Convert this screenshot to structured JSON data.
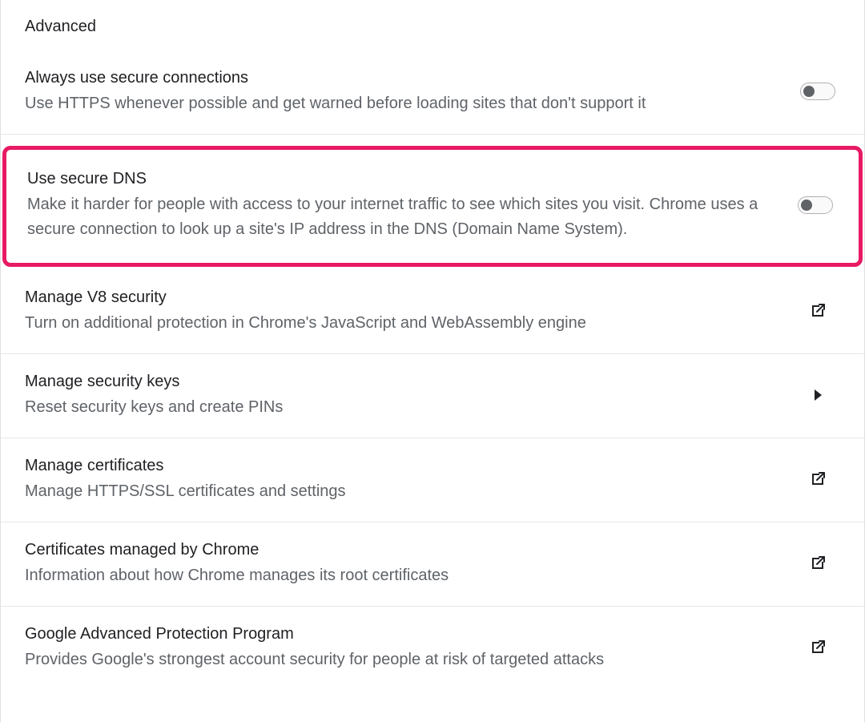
{
  "section": {
    "heading": "Advanced"
  },
  "rows": {
    "secure_connections": {
      "title": "Always use secure connections",
      "desc": "Use HTTPS whenever possible and get warned before loading sites that don't support it"
    },
    "secure_dns": {
      "title": "Use secure DNS",
      "desc": "Make it harder for people with access to your internet traffic to see which sites you visit. Chrome uses a secure connection to look up a site's IP address in the DNS (Domain Name System)."
    },
    "v8_security": {
      "title": "Manage V8 security",
      "desc": "Turn on additional protection in Chrome's JavaScript and WebAssembly engine"
    },
    "security_keys": {
      "title": "Manage security keys",
      "desc": "Reset security keys and create PINs"
    },
    "certificates": {
      "title": "Manage certificates",
      "desc": "Manage HTTPS/SSL certificates and settings"
    },
    "certs_chrome": {
      "title": "Certificates managed by Chrome",
      "desc": "Information about how Chrome manages its root certificates"
    },
    "gap": {
      "title": "Google Advanced Protection Program",
      "desc": "Provides Google's strongest account security for people at risk of targeted attacks"
    }
  }
}
